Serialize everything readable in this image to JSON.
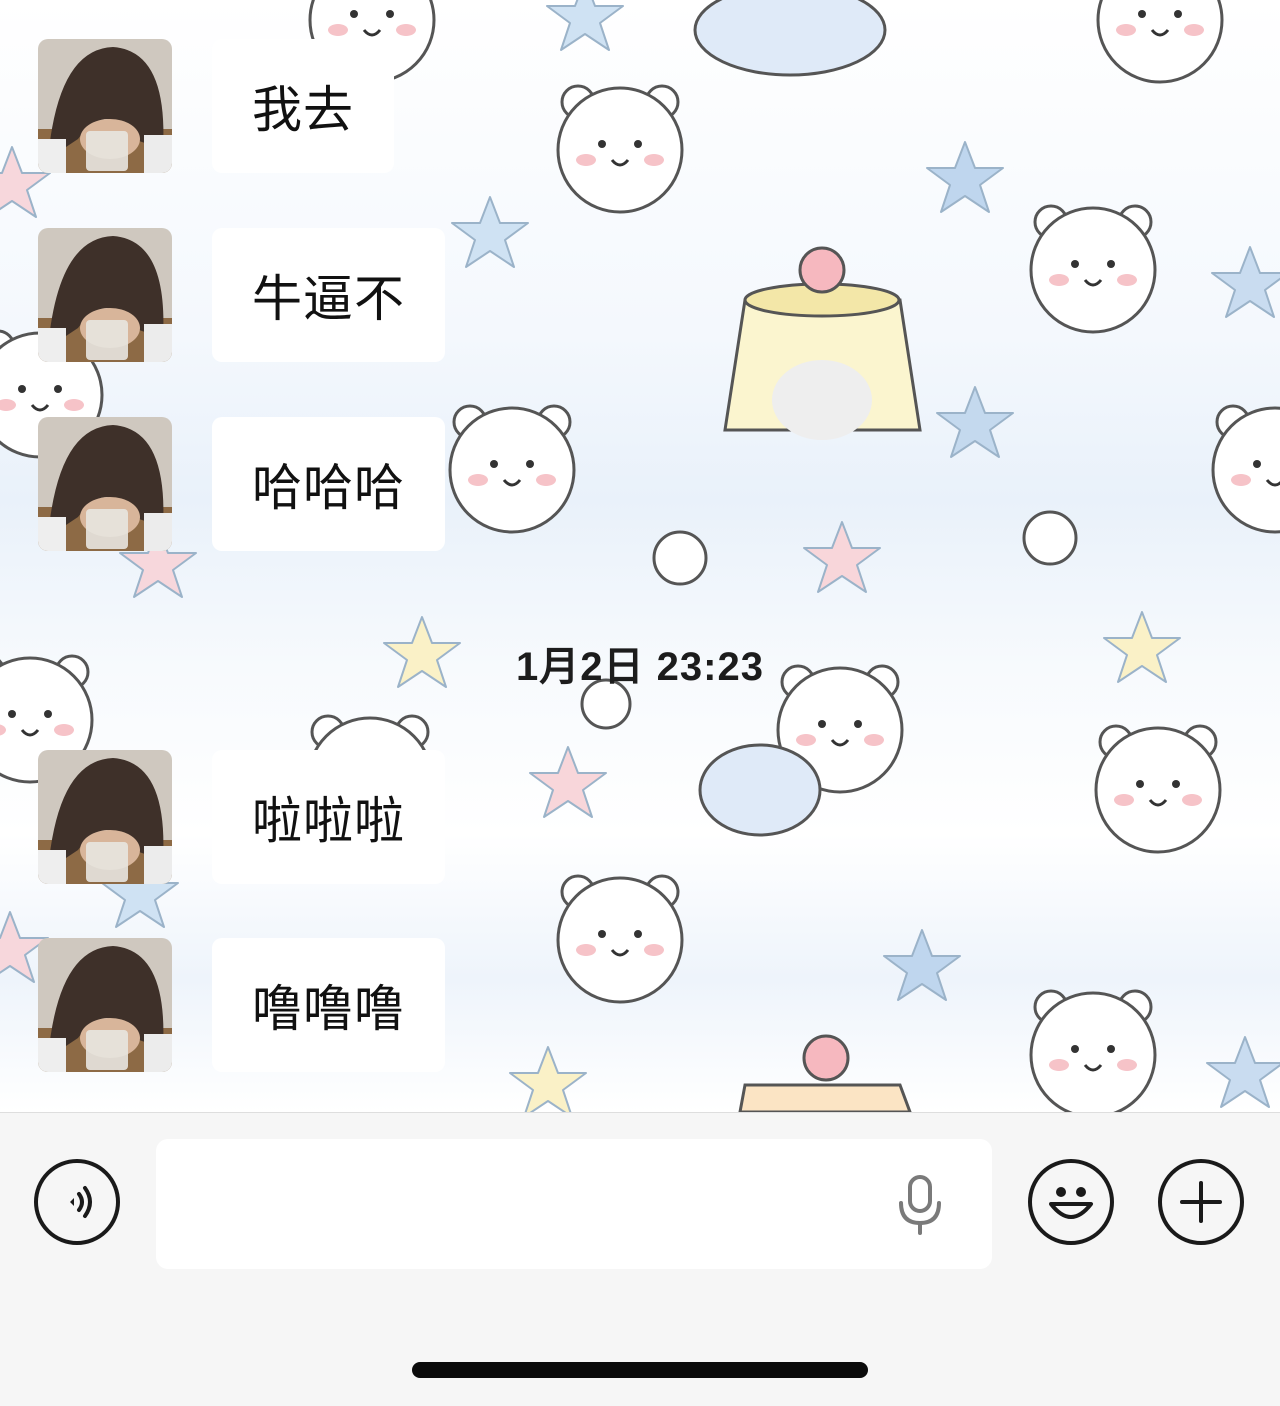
{
  "messages": [
    {
      "text": "我去"
    },
    {
      "text": "牛逼不"
    },
    {
      "text": "哈哈哈"
    },
    {
      "text": "啦啦啦"
    },
    {
      "text": "噜噜噜"
    }
  ],
  "timestamp": "1月2日 23:23",
  "input_bar": {
    "voice_toggle_icon": "voice-wave-icon",
    "mic_icon": "microphone-icon",
    "emoji_icon": "smiley-icon",
    "plus_icon": "plus-icon",
    "text_value": ""
  },
  "colors": {
    "bubble": "#ffffff",
    "input_bar_bg": "#f6f6f6",
    "text": "#111111"
  }
}
